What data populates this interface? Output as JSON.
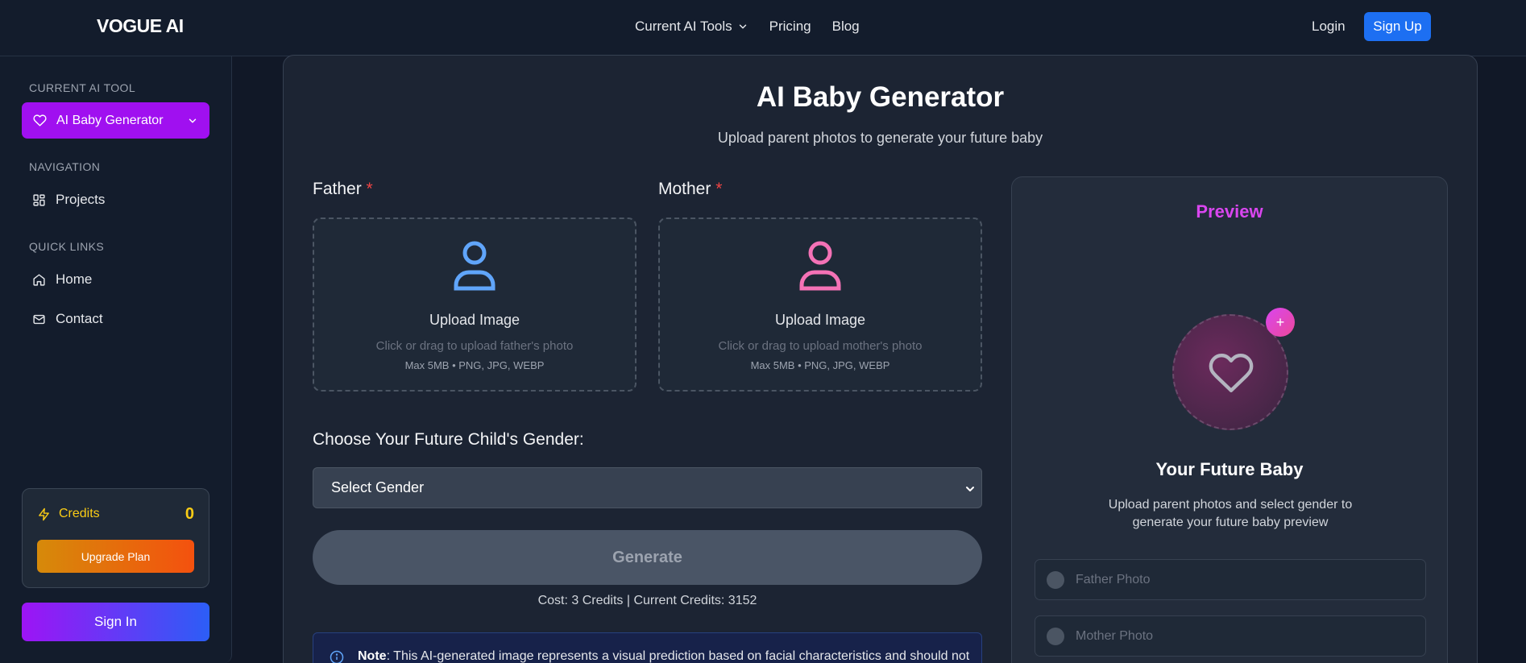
{
  "header": {
    "logo": "VOGUE AI",
    "nav": {
      "tools": "Current AI Tools",
      "pricing": "Pricing",
      "blog": "Blog"
    },
    "login": "Login",
    "signup": "Sign Up"
  },
  "sidebar": {
    "current_tool_label": "CURRENT AI TOOL",
    "current_tool": "AI Baby Generator",
    "navigation_label": "NAVIGATION",
    "projects": "Projects",
    "quick_links_label": "QUICK LINKS",
    "home": "Home",
    "contact": "Contact",
    "credits_label": "Credits",
    "credits_value": "0",
    "upgrade": "Upgrade Plan",
    "signin": "Sign In"
  },
  "main": {
    "title": "AI Baby Generator",
    "subtitle": "Upload parent photos to generate your future baby",
    "father": {
      "label": "Father",
      "required": "*",
      "upload_title": "Upload Image",
      "upload_hint": "Click or drag to upload father's photo",
      "upload_meta": "Max 5MB • PNG, JPG, WEBP"
    },
    "mother": {
      "label": "Mother",
      "required": "*",
      "upload_title": "Upload Image",
      "upload_hint": "Click or drag to upload mother's photo",
      "upload_meta": "Max 5MB • PNG, JPG, WEBP"
    },
    "gender_label": "Choose Your Future Child's Gender:",
    "gender_select": "Select Gender",
    "generate": "Generate",
    "cost": "Cost: 3 Credits | Current Credits: 3152",
    "note_bold": "Note",
    "note_text": ": This AI-generated image represents a visual prediction based on facial characteristics and should not"
  },
  "preview": {
    "title": "Preview",
    "plus": "+",
    "baby_title": "Your Future Baby",
    "baby_desc": "Upload parent photos and select gender to generate your future baby preview",
    "father_status": "Father Photo",
    "mother_status": "Mother Photo"
  },
  "colors": {
    "accent_purple": "#a010f0",
    "brand_blue": "#1d6ff2",
    "father_icon": "#60a5fa",
    "mother_icon": "#f472b6",
    "preview_title": "#d946ef",
    "credits": "#facc15"
  },
  "icons": [
    "chevron-down-icon",
    "heart-icon",
    "grid-icon",
    "home-icon",
    "mail-icon",
    "lightning-icon",
    "person-icon",
    "info-icon"
  ]
}
